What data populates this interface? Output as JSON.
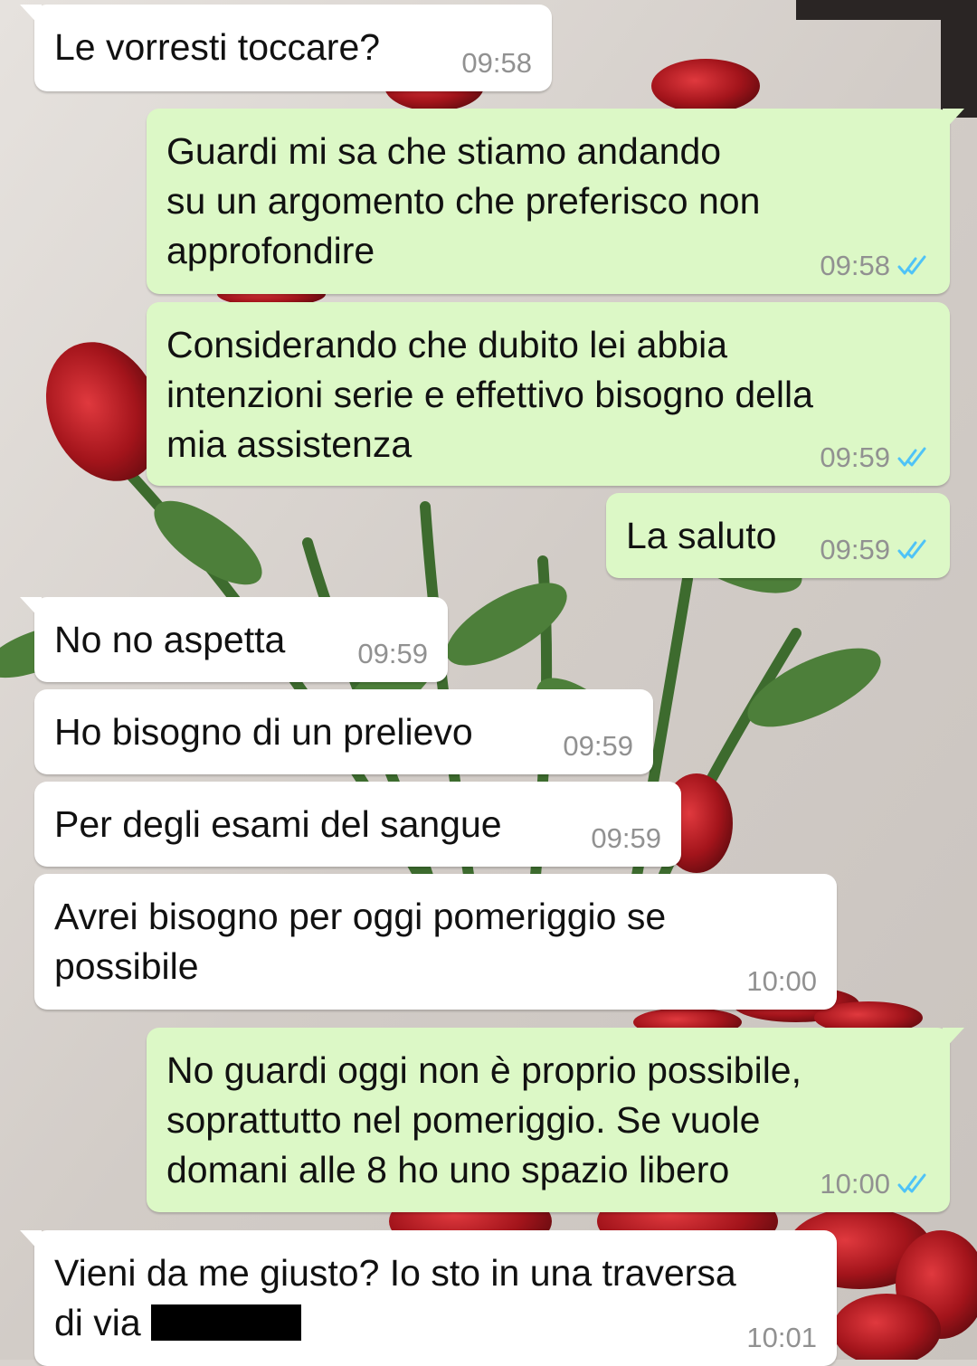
{
  "colors": {
    "incoming_bubble": "#ffffff",
    "outgoing_bubble": "#dcf8c6",
    "timestamp": "#919191",
    "read_ticks": "#4fc3f7"
  },
  "messages": [
    {
      "lines": [
        "Le vorresti toccare?"
      ],
      "time": "09:58",
      "direction": "incoming",
      "status": ""
    },
    {
      "lines": [
        "Guardi mi sa che stiamo andando",
        "su un argomento che preferisco non",
        "approfondire"
      ],
      "time": "09:58",
      "direction": "outgoing",
      "status": "read-ticks-icon"
    },
    {
      "lines": [
        "Considerando che dubito lei abbia",
        "intenzioni serie e effettivo bisogno della",
        "mia assistenza"
      ],
      "time": "09:59",
      "direction": "outgoing",
      "status": "read-ticks-icon"
    },
    {
      "lines": [
        "La saluto"
      ],
      "time": "09:59",
      "direction": "outgoing",
      "status": "read-ticks-icon"
    },
    {
      "lines": [
        "No no aspetta"
      ],
      "time": "09:59",
      "direction": "incoming",
      "status": ""
    },
    {
      "lines": [
        "Ho bisogno di un prelievo"
      ],
      "time": "09:59",
      "direction": "incoming",
      "status": ""
    },
    {
      "lines": [
        "Per degli esami del sangue"
      ],
      "time": "09:59",
      "direction": "incoming",
      "status": ""
    },
    {
      "lines": [
        "Avrei bisogno per oggi pomeriggio se",
        "possibile"
      ],
      "time": "10:00",
      "direction": "incoming",
      "status": ""
    },
    {
      "lines": [
        "No guardi oggi non è proprio possibile,",
        "soprattutto nel pomeriggio. Se vuole",
        "domani alle 8 ho uno spazio libero"
      ],
      "time": "10:00",
      "direction": "outgoing",
      "status": "read-ticks-icon"
    },
    {
      "lines": [
        "Vieni da me giusto? Io sto in una traversa",
        "di via "
      ],
      "time": "10:01",
      "direction": "incoming",
      "status": "",
      "redacted_suffix": true
    }
  ]
}
